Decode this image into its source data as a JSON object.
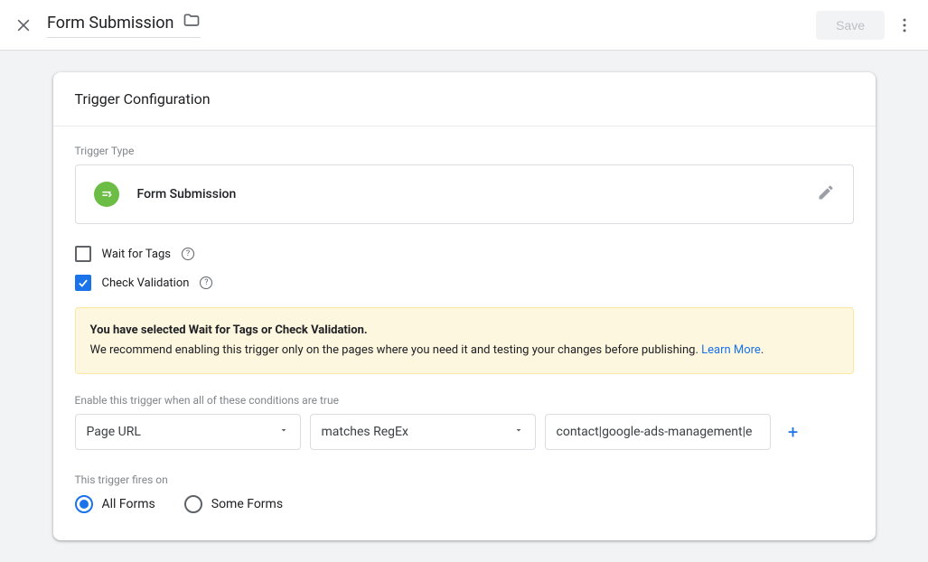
{
  "header": {
    "title": "Form Submission",
    "save_label": "Save"
  },
  "card": {
    "title": "Trigger Configuration",
    "trigger_type_label": "Trigger Type",
    "trigger_type_name": "Form Submission",
    "wait_for_tags": {
      "label": "Wait for Tags",
      "checked": false
    },
    "check_validation": {
      "label": "Check Validation",
      "checked": true
    },
    "warning": {
      "title": "You have selected Wait for Tags or Check Validation.",
      "body": "We recommend enabling this trigger only on the pages where you need it and testing your changes before publishing. ",
      "link_text": "Learn More",
      "period": "."
    },
    "conditions_label": "Enable this trigger when all of these conditions are true",
    "condition": {
      "variable": "Page URL",
      "operator": "matches RegEx",
      "value": "contact|google-ads-management|e"
    },
    "fires_on_label": "This trigger fires on",
    "radios": {
      "all": "All Forms",
      "some": "Some Forms",
      "selected": "all"
    }
  }
}
